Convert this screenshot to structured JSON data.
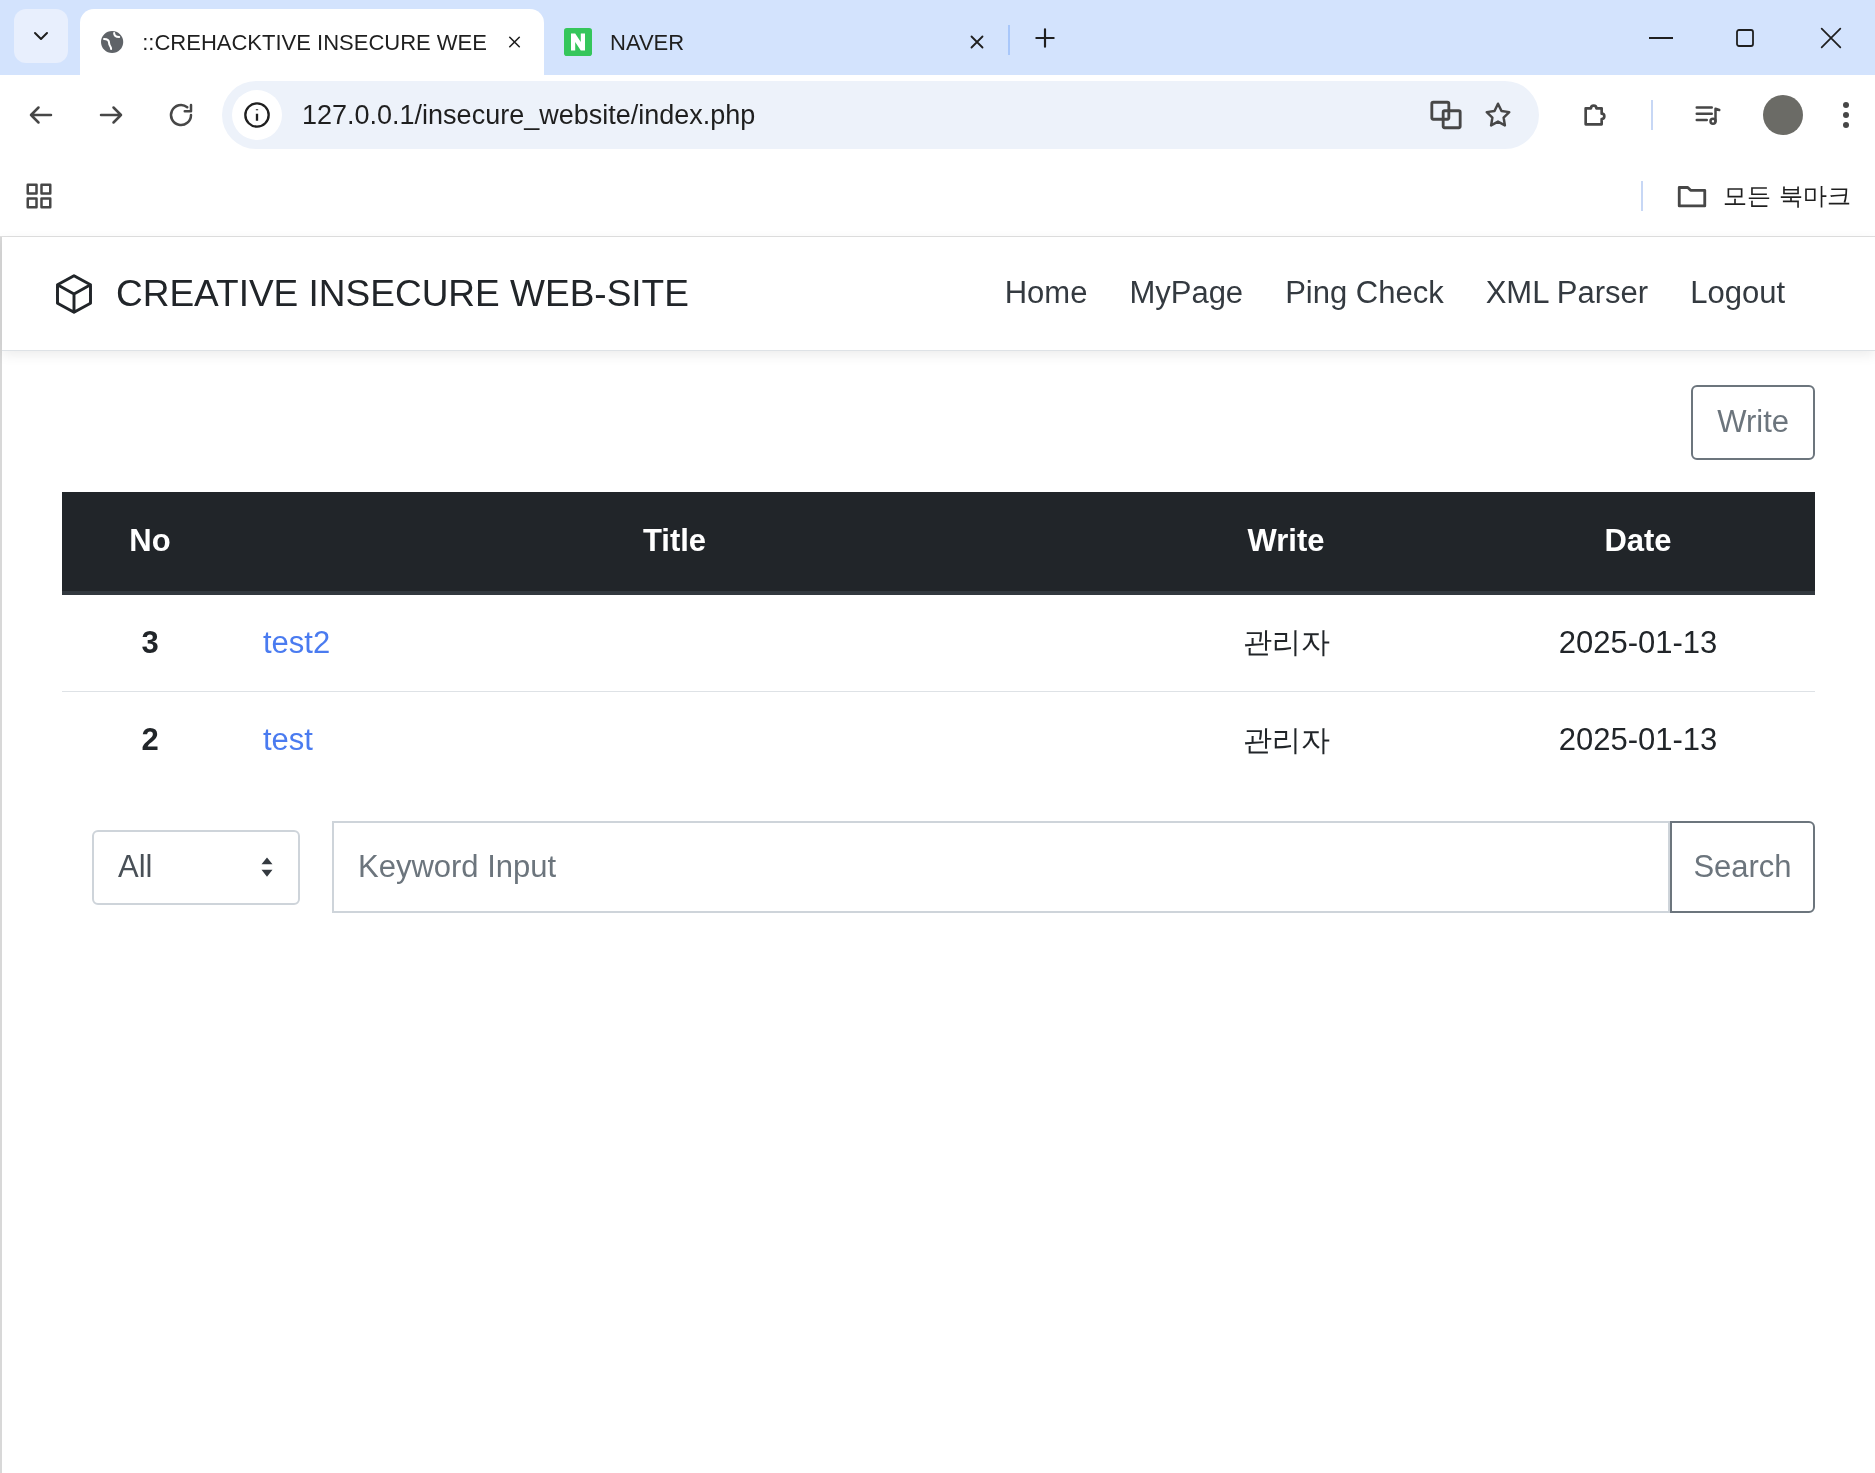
{
  "browser": {
    "tabs": [
      {
        "title": "::CREHACKTIVE INSECURE WEE",
        "selected": true,
        "kind": "globe"
      },
      {
        "title": "NAVER",
        "selected": false,
        "kind": "letter-logo"
      }
    ],
    "address": "127.0.0.1/insecure_website/index.php",
    "bookmarks_label": "모든 북마크"
  },
  "navbar": {
    "brand": "CREATIVE INSECURE WEB-SITE",
    "links": [
      "Home",
      "MyPage",
      "Ping Check",
      "XML Parser",
      "Logout"
    ]
  },
  "write_button": "Write",
  "table": {
    "columns": [
      "No",
      "Title",
      "Write",
      "Date"
    ],
    "rows": [
      {
        "no": "3",
        "title": "test2",
        "writer": "관리자",
        "date": "2025-01-13"
      },
      {
        "no": "2",
        "title": "test",
        "writer": "관리자",
        "date": "2025-01-13"
      }
    ]
  },
  "search": {
    "filter": "All",
    "placeholder": "Keyword Input",
    "button": "Search"
  }
}
